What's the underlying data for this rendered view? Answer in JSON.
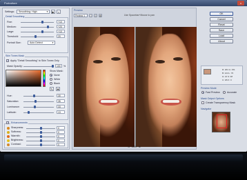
{
  "app": {
    "title": "Portraiture",
    "close_label": "x"
  },
  "settings": {
    "label": "Settings:",
    "value": "Smoothing: High"
  },
  "detail_smoothing": {
    "title": "Detail Smoothing",
    "rows": [
      {
        "label": "Fine:",
        "value": "+10"
      },
      {
        "label": "Medium:",
        "value": "+20"
      },
      {
        "label": "Large:",
        "value": "+10"
      },
      {
        "label": "Threshold:",
        "value": "20"
      }
    ],
    "portrait_size_label": "Portrait Size:",
    "portrait_size_value": "Auto Detect"
  },
  "skin_tones_mask": {
    "title": "Skin Tones Mask",
    "apply_label": "Apply \"Detail Smoothing\" to Skin Tones Only",
    "mask_opacity_label": "Mask Opacity:",
    "mask_opacity_value": "100",
    "mask_opacity_unit": "%",
    "show_mask_label": "Show Mask:",
    "show_mask_options": [
      "None",
      "White",
      "Black"
    ],
    "rows": [
      {
        "label": "Hue:",
        "value": "30"
      },
      {
        "label": "Saturation:",
        "value": "35"
      },
      {
        "label": "Luminance:",
        "value": "33"
      },
      {
        "label": "Latitude:",
        "value": "13"
      }
    ]
  },
  "enhancements": {
    "title": "Enhancements",
    "rows": [
      {
        "label": "Sharpness:",
        "value": "0",
        "color": "#d98a1e"
      },
      {
        "label": "Softness:",
        "value": "0",
        "color": "#d9b21e"
      },
      {
        "label": "Warmth:",
        "value": "0",
        "color": "#e06a1a"
      },
      {
        "label": "Brightness:",
        "value": "0",
        "color": "#e5c31a"
      },
      {
        "label": "Contrast:",
        "value": "0",
        "color": "#d38a2a"
      }
    ]
  },
  "preview": {
    "tab_label": "Preview",
    "select_value": "Preview 1",
    "hint": "Use Spacebar+Mouse to pan",
    "zoom": "25%"
  },
  "right": {
    "buttons": [
      "OK",
      "Cancel",
      "Reset",
      "Save",
      "Load",
      "About"
    ],
    "info": [
      "R: 201 G: 151",
      "B: 124 L: 70",
      "H: 21 S: 38",
      "C: 1B K: 0"
    ],
    "preview_mode_title": "Preview Mode",
    "preview_modes": [
      "Fast Preview",
      "Accurate"
    ],
    "output_title": "Mask Output Options",
    "output_check": "Create Transparency Mask",
    "navigator_title": "Navigator"
  }
}
